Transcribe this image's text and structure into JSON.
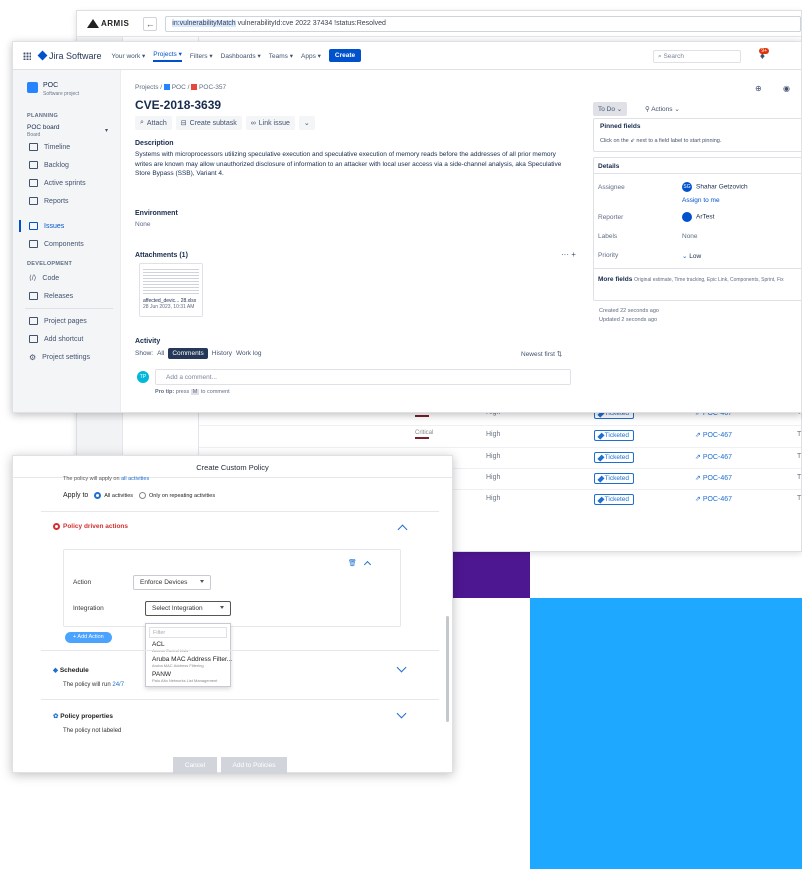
{
  "armis": {
    "logo": "ARMIS",
    "query_highlight": "in:vulnerabilityMatch",
    "query_rest": " vulnerabilityId:cve 2022 37434 !status:Resolved",
    "rows": [
      {
        "severity": "Critical",
        "level": "High",
        "status": "Ticketed",
        "ticket": "POC-467",
        "trail": "T"
      },
      {
        "severity": "Critical",
        "level": "High",
        "status": "Ticketed",
        "ticket": "POC-467",
        "trail": "T"
      },
      {
        "severity": "",
        "level": "High",
        "status": "Ticketed",
        "ticket": "POC-467",
        "trail": "T"
      },
      {
        "severity": "",
        "level": "High",
        "status": "Ticketed",
        "ticket": "POC-467",
        "trail": "T"
      },
      {
        "severity": "",
        "level": "High",
        "status": "Ticketed",
        "ticket": "POC-467",
        "trail": "T"
      }
    ]
  },
  "jira": {
    "brand": "Jira Software",
    "nav": [
      "Your work",
      "Projects",
      "Filters",
      "Dashboards",
      "Teams",
      "Apps"
    ],
    "create": "Create",
    "search_placeholder": "Search",
    "badge": "9+",
    "project": {
      "name": "POC",
      "type": "Software project"
    },
    "sections": {
      "planning": "PLANNING",
      "development": "DEVELOPMENT"
    },
    "board": {
      "name": "POC board",
      "sub": "Board"
    },
    "side_planning": [
      "Timeline",
      "Backlog",
      "Active sprints",
      "Reports"
    ],
    "side_issues": [
      "Issues",
      "Components"
    ],
    "side_dev": [
      "Code",
      "Releases"
    ],
    "side_bottom": [
      "Project pages",
      "Add shortcut",
      "Project settings"
    ],
    "breadcrumb": {
      "projects": "Projects",
      "project": "POC",
      "issue": "POC-357"
    },
    "issue_title": "CVE-2018-3639",
    "actions": {
      "attach": "Attach",
      "subtask": "Create subtask",
      "link": "Link issue"
    },
    "description_label": "Description",
    "description": "Systems with microprocessors utilizing speculative execution and speculative execution of memory reads before the addresses of all prior memory writes are known may allow unauthorized disclosure of information to an attacker with local user access via a side-channel analysis, aka Speculative Store Bypass (SSB), Variant 4.",
    "environment_label": "Environment",
    "environment": "None",
    "attachments_label": "Attachments (1)",
    "attachment": {
      "name": "affected_devic... 28.xlsx",
      "date": "28 Jun 2023, 10:31 AM"
    },
    "activity_label": "Activity",
    "show_label": "Show:",
    "tabs": [
      "All",
      "Comments",
      "History",
      "Work log"
    ],
    "sort": "Newest first",
    "comment_avatar": "TP",
    "comment_placeholder": "Add a comment...",
    "pro_tip_prefix": "Pro tip:",
    "pro_tip_press": "press",
    "pro_tip_key": "M",
    "pro_tip_suffix": "to comment",
    "status": "To Do",
    "actions_menu": "Actions",
    "pinned_title": "Pinned fields",
    "pinned_hint": "Click on the ⇙ next to a field label to start pinning.",
    "details_title": "Details",
    "fields": {
      "assignee_label": "Assignee",
      "assignee": "Shahar Getzovich",
      "assign_me": "Assign to me",
      "assignee_initials": "SG",
      "reporter_label": "Reporter",
      "reporter": "ArTest",
      "labels_label": "Labels",
      "labels": "None",
      "priority_label": "Priority",
      "priority": "Low"
    },
    "more_fields": "More fields",
    "more_fields_list": "Original estimate, Time tracking, Epic Link, Components, Sprint, Fix",
    "created": "Created 22 seconds ago",
    "updated": "Updated 2 seconds ago"
  },
  "policy": {
    "title": "Create Custom Policy",
    "apply_note_prefix": "The policy will apply on ",
    "apply_note_link": "all activities",
    "apply_to": "Apply to",
    "opt_all": "All activities",
    "opt_repeat": "Only on repeating activities",
    "driven_actions": "Policy driven actions",
    "action_label": "Action",
    "action_value": "Enforce Devices",
    "integration_label": "Integration",
    "integration_value": "Select Integration",
    "filter_placeholder": "Filter",
    "options": [
      {
        "name": "ACL",
        "desc": "Access Control Lists"
      },
      {
        "name": "Aruba MAC Address Filter...",
        "desc": "Aruba MAC Address Filtering"
      },
      {
        "name": "PANW",
        "desc": "Palo Alto Networks List Management"
      }
    ],
    "add_action": "+ Add Action",
    "schedule": "Schedule",
    "schedule_note": "The policy will run ",
    "schedule_link": "24/7",
    "properties": "Policy properties",
    "properties_note": "The policy not labeled",
    "cancel": "Cancel",
    "submit": "Add to Policies"
  },
  "colors": {
    "jira_blue": "#0052cc",
    "armis_blue": "#1f6fd1",
    "purple": "#4e1792",
    "sky": "#1fa8ff",
    "danger": "#de350b"
  }
}
